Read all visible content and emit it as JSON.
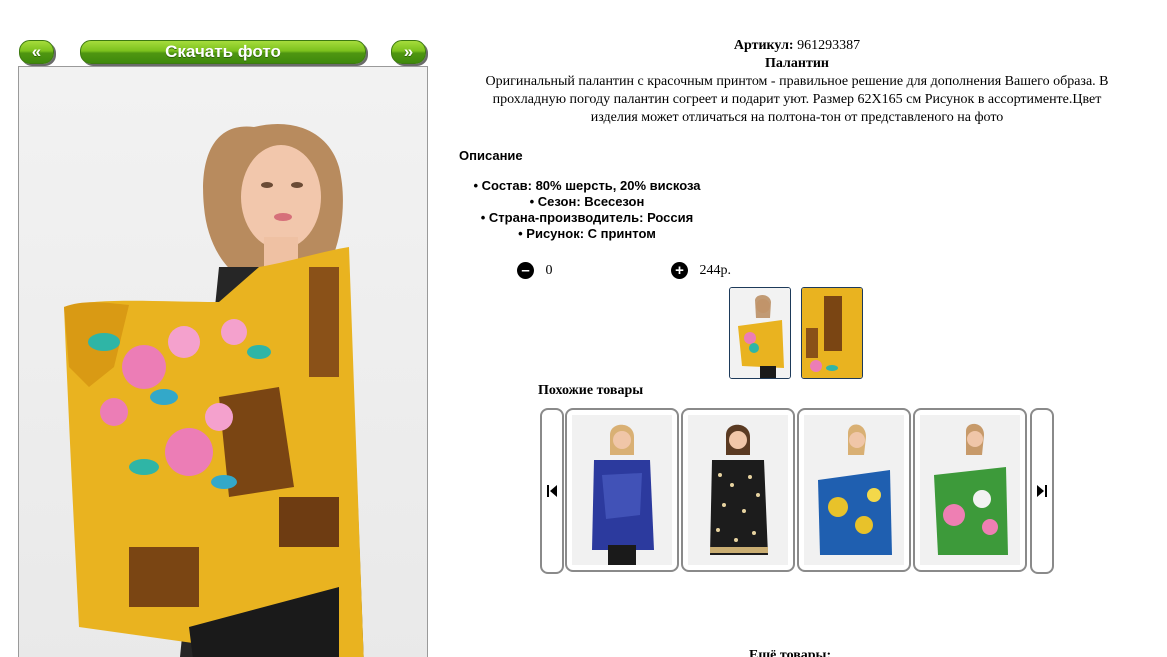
{
  "nav": {
    "prev_label": "«",
    "download_label": "Скачать фото",
    "next_label": "»"
  },
  "product": {
    "article_label": "Артикул:",
    "article_value": "961293387",
    "name": "Палантин",
    "description_line1": "Оригинальный палантин с красочным принтом - правильное решение для дополнения Вашего образа. В",
    "description_line2": "прохладную погоду палантин согреет и подарит уют. Размер 62Х165 см Рисунок в ассортименте.Цвет",
    "description_line3": "изделия может отличаться на полтона-тон от представленого на фото"
  },
  "description": {
    "title": "Описание",
    "specs": [
      "Состав: 80% шерсть, 20% вискоза",
      "Сезон: Всесезон",
      "Страна-производитель: Россия",
      "Рисунок: С принтом"
    ]
  },
  "quantity": {
    "minus_icon": "minus-circle-icon",
    "value": "0",
    "plus_icon": "plus-circle-icon",
    "price": "244р."
  },
  "similar": {
    "title": "Похожие товары",
    "prev_icon": "skip-back-icon",
    "next_icon": "skip-forward-icon"
  },
  "more": {
    "title": "Ещё товары:"
  },
  "colors": {
    "button_green": "#7cc21d",
    "scarf_yellow": "#e9b320",
    "scarf_brown": "#7a4513"
  }
}
